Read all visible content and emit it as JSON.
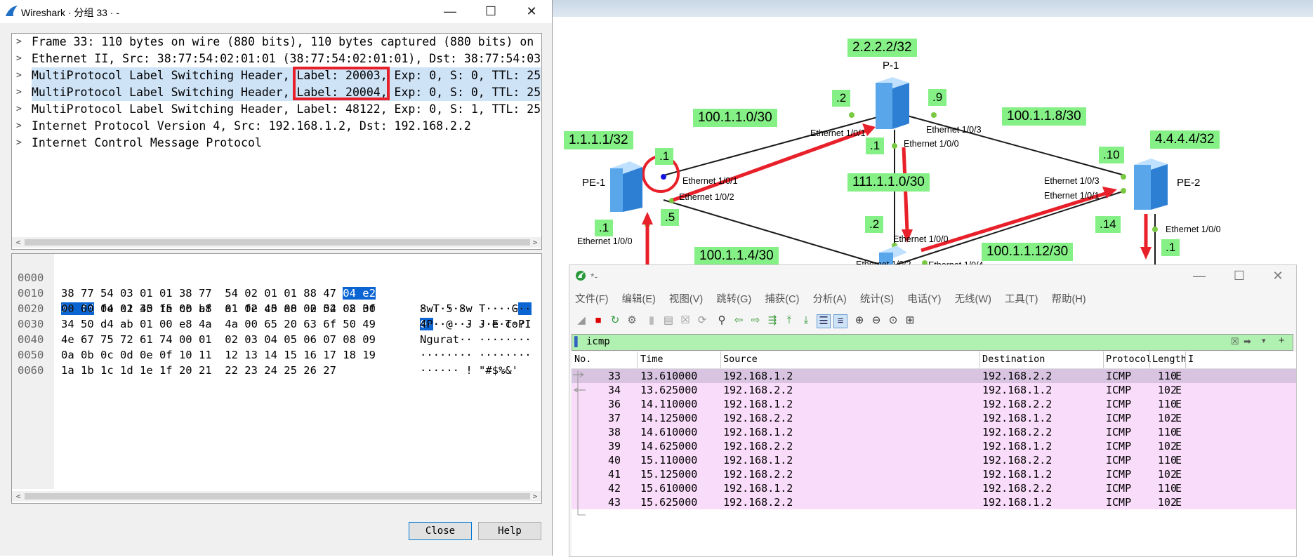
{
  "colors": {
    "label_green": "#85f085",
    "highlight": "#cfe3f7",
    "selection": "#0a64d2",
    "arrow_red": "#e8202a",
    "row_pink": "#f9dcf9",
    "row_selected": "#d8c3e0"
  },
  "packet_window": {
    "title": "Wireshark · 分组 33 · -",
    "tree": [
      "Frame 33: 110 bytes on wire (880 bits), 110 bytes captured (880 bits) on",
      "Ethernet II, Src: 38:77:54:02:01:01 (38:77:54:02:01:01), Dst: 38:77:54:03",
      "MultiProtocol Label Switching Header, Label: 20003, Exp: 0, S: 0, TTL: 25",
      "MultiProtocol Label Switching Header, Label: 20004, Exp: 0, S: 0, TTL: 25",
      "MultiProtocol Label Switching Header, Label: 48122, Exp: 0, S: 1, TTL: 25",
      "Internet Protocol Version 4, Src: 192.168.1.2, Dst: 192.168.2.2",
      "Internet Control Message Protocol"
    ],
    "hex": [
      {
        "off": "0000",
        "bytes": "38 77 54 03 01 01 38 77  54 02 01 01 88 47 ",
        "sel_bytes": "04 e2",
        "ascii": "8wT···8w T····G",
        "sel_ascii": "··"
      },
      {
        "off": "0010",
        "sel_bytes": "30 fd",
        "bytes": " 04 e2 40 fe 0b bf  a1 fe 45 00 00 54 02 3f",
        "sel_ascii": "0·",
        "ascii": "··@··· ··E·T·?"
      },
      {
        "off": "0020",
        "bytes": "00 00 fe 01 35 15 c0 a8  01 02 c0 a8 02 02 08 00",
        "ascii": "····5··· ········"
      },
      {
        "off": "0030",
        "bytes": "34 50 d4 ab 01 00 e8 4a  4a 00 65 20 63 6f 50 49",
        "ascii": "4P·····J J·e coPI"
      },
      {
        "off": "0040",
        "bytes": "4e 67 75 72 61 74 00 01  02 03 04 05 06 07 08 09",
        "ascii": "Ngurat·· ········"
      },
      {
        "off": "0050",
        "bytes": "0a 0b 0c 0d 0e 0f 10 11  12 13 14 15 16 17 18 19",
        "ascii": "········ ········"
      },
      {
        "off": "0060",
        "bytes": "1a 1b 1c 1d 1e 1f 20 21  22 23 24 25 26 27",
        "ascii": "······ ! \"#$%&'"
      }
    ],
    "close_label": "Close",
    "help_label": "Help"
  },
  "topology": {
    "nodes": {
      "pe1": "PE-1",
      "p1": "P-1",
      "pe2": "PE-2"
    },
    "loopbacks": {
      "pe1": "1.1.1.1/32",
      "p1": "2.2.2.2/32",
      "pe2": "4.4.4.4/32"
    },
    "subnets": [
      "100.1.1.0/30",
      "100.1.1.8/30",
      "111.1.1.0/30",
      "100.1.1.4/30",
      "100.1.1.12/30"
    ],
    "hosts": [
      ".2",
      ".9",
      ".1",
      ".1",
      ".10",
      ".5",
      ".2",
      ".14",
      ".1",
      ".1"
    ],
    "ports": [
      "Ethernet 1/0/1",
      "Ethernet 1/0/3",
      "Ethernet 1/0/0",
      "Ethernet 1/0/1",
      "Ethernet 1/0/2",
      "Ethernet 1/0/0",
      "Ethernet 1/0/3",
      "Ethernet 1/0/1",
      "Ethernet 1/0/0",
      "Ethernet 1/0/0",
      "Ethernet 1/0/2",
      "Ethernet 1/0/4"
    ]
  },
  "main_window": {
    "title": "*-",
    "menu": [
      "文件(F)",
      "编辑(E)",
      "视图(V)",
      "跳转(G)",
      "捕获(C)",
      "分析(A)",
      "统计(S)",
      "电话(Y)",
      "无线(W)",
      "工具(T)",
      "帮助(H)"
    ],
    "filter": "icmp",
    "columns": [
      "No.",
      "Time",
      "Source",
      "Destination",
      "Protocol",
      "Length",
      "I"
    ],
    "rows": [
      {
        "no": "33",
        "time": "13.610000",
        "src": "192.168.1.2",
        "dst": "192.168.2.2",
        "proto": "ICMP",
        "len": "110",
        "info": "E"
      },
      {
        "no": "34",
        "time": "13.625000",
        "src": "192.168.2.2",
        "dst": "192.168.1.2",
        "proto": "ICMP",
        "len": "102",
        "info": "E"
      },
      {
        "no": "36",
        "time": "14.110000",
        "src": "192.168.1.2",
        "dst": "192.168.2.2",
        "proto": "ICMP",
        "len": "110",
        "info": "E"
      },
      {
        "no": "37",
        "time": "14.125000",
        "src": "192.168.2.2",
        "dst": "192.168.1.2",
        "proto": "ICMP",
        "len": "102",
        "info": "E"
      },
      {
        "no": "38",
        "time": "14.610000",
        "src": "192.168.1.2",
        "dst": "192.168.2.2",
        "proto": "ICMP",
        "len": "110",
        "info": "E"
      },
      {
        "no": "39",
        "time": "14.625000",
        "src": "192.168.2.2",
        "dst": "192.168.1.2",
        "proto": "ICMP",
        "len": "102",
        "info": "E"
      },
      {
        "no": "40",
        "time": "15.110000",
        "src": "192.168.1.2",
        "dst": "192.168.2.2",
        "proto": "ICMP",
        "len": "110",
        "info": "E"
      },
      {
        "no": "41",
        "time": "15.125000",
        "src": "192.168.2.2",
        "dst": "192.168.1.2",
        "proto": "ICMP",
        "len": "102",
        "info": "E"
      },
      {
        "no": "42",
        "time": "15.610000",
        "src": "192.168.1.2",
        "dst": "192.168.2.2",
        "proto": "ICMP",
        "len": "110",
        "info": "E"
      },
      {
        "no": "43",
        "time": "15.625000",
        "src": "192.168.2.2",
        "dst": "192.168.1.2",
        "proto": "ICMP",
        "len": "102",
        "info": "E"
      }
    ]
  }
}
